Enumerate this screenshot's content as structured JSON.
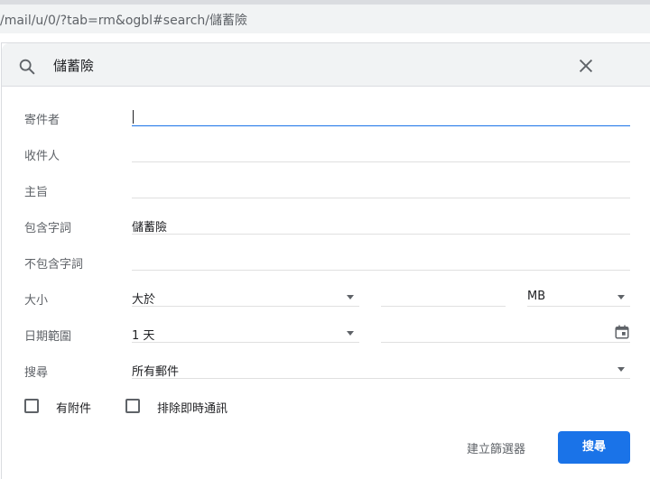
{
  "browser": {
    "url": "/mail/u/0/?tab=rm&ogbl#search/儲蓄險"
  },
  "search": {
    "query": "儲蓄險"
  },
  "form": {
    "from_label": "寄件者",
    "from_value": "",
    "to_label": "收件人",
    "to_value": "",
    "subject_label": "主旨",
    "subject_value": "",
    "has_words_label": "包含字詞",
    "has_words_value": "儲蓄險",
    "doesnt_have_label": "不包含字詞",
    "doesnt_have_value": "",
    "size_label": "大小",
    "size_operator": "大於",
    "size_value": "",
    "size_unit": "MB",
    "date_label": "日期範圍",
    "date_within": "1 天",
    "date_value": "",
    "search_in_label": "搜尋",
    "search_in_value": "所有郵件",
    "has_attachment_label": "有附件",
    "has_attachment_checked": false,
    "exclude_chats_label": "排除即時通訊",
    "exclude_chats_checked": false
  },
  "actions": {
    "create_filter_label": "建立篩選器",
    "search_label": "搜尋"
  },
  "icons": {
    "search": "search-icon",
    "close": "close-icon",
    "calendar": "calendar-icon"
  },
  "colors": {
    "accent": "#1a73e8",
    "bar_background": "#f1f3f4",
    "label_text": "#5f6368"
  }
}
